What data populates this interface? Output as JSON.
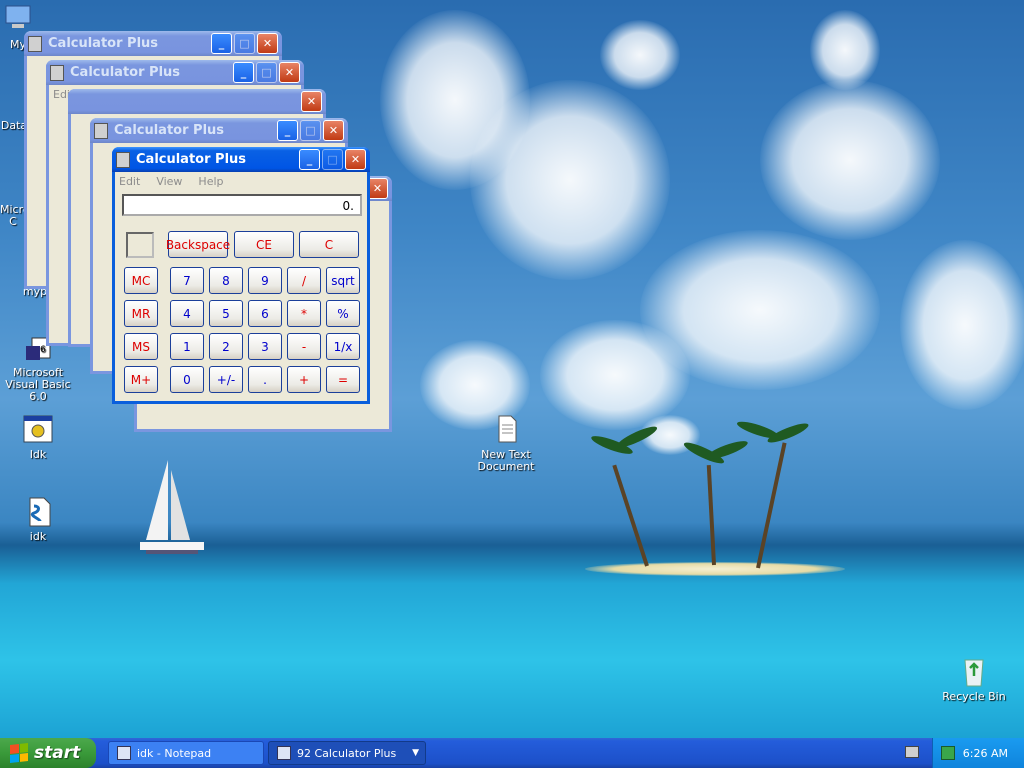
{
  "desktop": {
    "icons": [
      {
        "name": "my-computer",
        "label": "My",
        "icon": "computer-icon"
      },
      {
        "name": "data",
        "label": "Data",
        "icon": "folder-icon"
      },
      {
        "name": "microsoft",
        "label": "Micro C",
        "icon": "app-icon"
      },
      {
        "name": "myp",
        "label": "myp",
        "icon": "app-icon"
      },
      {
        "name": "vb6",
        "label": "Microsoft Visual Basic 6.0",
        "icon": "vb6-icon"
      },
      {
        "name": "idk-exe",
        "label": "Idk",
        "icon": "exe-icon"
      },
      {
        "name": "idk-script",
        "label": "idk",
        "icon": "script-icon"
      },
      {
        "name": "new-text-doc",
        "label": "New Text Document",
        "icon": "text-file-icon"
      },
      {
        "name": "recycle-bin",
        "label": "Recycle Bin",
        "icon": "recycle-bin-icon"
      }
    ]
  },
  "calculator": {
    "title": "Calculator Plus",
    "menu": [
      "Edit",
      "View",
      "Help"
    ],
    "display": "0.",
    "top_row": [
      "Backspace",
      "CE",
      "C"
    ],
    "memory": [
      "MC",
      "MR",
      "MS",
      "M+"
    ],
    "rows": [
      [
        "7",
        "8",
        "9",
        "/",
        "sqrt"
      ],
      [
        "4",
        "5",
        "6",
        "*",
        "%"
      ],
      [
        "1",
        "2",
        "3",
        "-",
        "1/x"
      ],
      [
        "0",
        "+/-",
        ".",
        "+",
        "="
      ]
    ]
  },
  "taskbar": {
    "start_label": "start",
    "tasks": [
      {
        "label": "idk - Notepad",
        "icon": "notepad-icon"
      },
      {
        "label": "92 Calculator Plus",
        "icon": "calculator-icon"
      }
    ],
    "clock": "6:26 AM"
  },
  "colors": {
    "accent": "#0055e5",
    "start_green": "#3a9a3a",
    "digit_blue": "#0000cc",
    "op_red": "#dd0000"
  }
}
